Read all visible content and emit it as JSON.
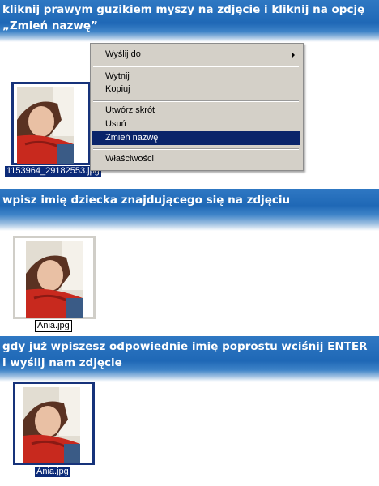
{
  "step1": {
    "line1": "kliknij prawym guzikiem myszy na zdjęcie i kliknij na opcję",
    "line2": "„Zmień nazwę”"
  },
  "step2": {
    "line1": "wpisz imię dziecka znajdującego się na zdjęciu"
  },
  "step3": {
    "line1": "gdy już wpiszesz odpowiednie imię poprostu wciśnij ENTER",
    "line2": "i wyślij nam zdjęcie"
  },
  "files": {
    "original": "1153964_29182553.jpg",
    "editing": "Ania.jpg",
    "renamed": "Ania.jpg"
  },
  "context_menu": {
    "send_to": "Wyślij do",
    "cut": "Wytnij",
    "copy": "Kopiuj",
    "create_shortcut": "Utwórz skrót",
    "delete": "Usuń",
    "rename": "Zmień nazwę",
    "properties": "Właściwości"
  },
  "colors": {
    "banner": "#1f68b6",
    "selection": "#0a246a",
    "menu_bg": "#d4d0c8"
  }
}
